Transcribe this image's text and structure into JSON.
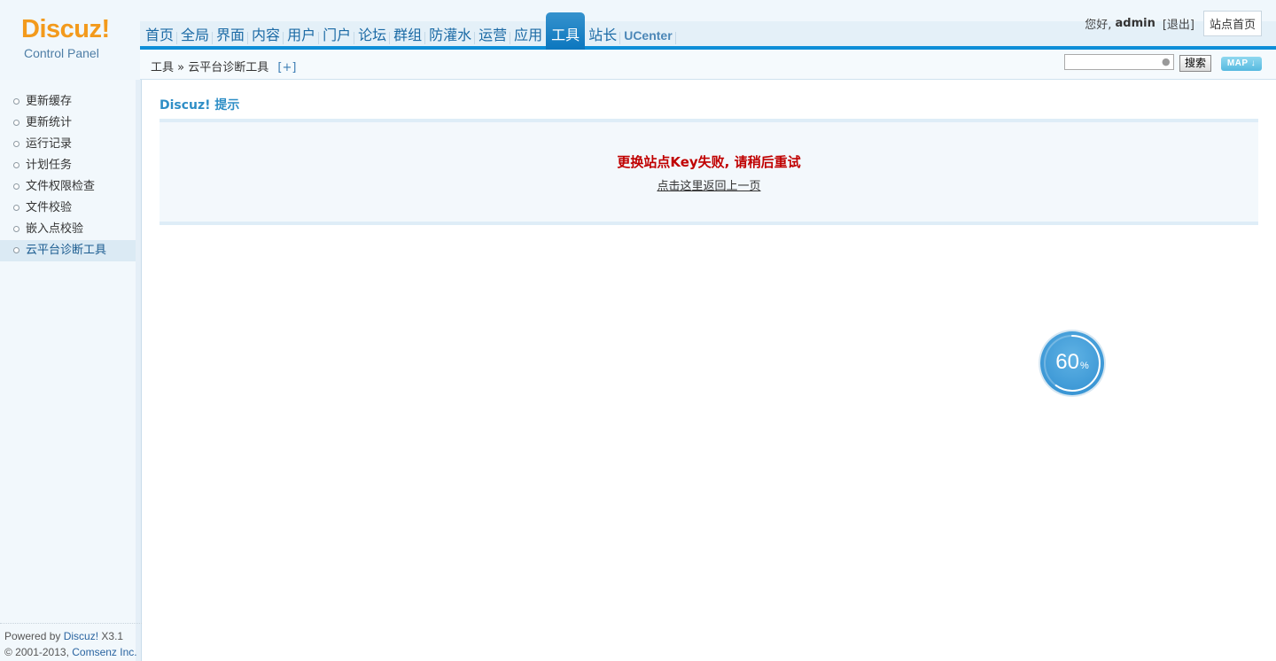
{
  "logo": {
    "brand": "Discuz!",
    "subtitle": "Control Panel"
  },
  "nav": {
    "items": [
      {
        "label": "首页"
      },
      {
        "label": "全局"
      },
      {
        "label": "界面"
      },
      {
        "label": "内容"
      },
      {
        "label": "用户"
      },
      {
        "label": "门户"
      },
      {
        "label": "论坛"
      },
      {
        "label": "群组"
      },
      {
        "label": "防灌水"
      },
      {
        "label": "运营"
      },
      {
        "label": "应用"
      },
      {
        "label": "工具"
      },
      {
        "label": "站长"
      },
      {
        "label": "UCenter"
      }
    ],
    "active": "工具"
  },
  "user": {
    "greeting": "您好,",
    "name": "admin",
    "logout": "[退出]",
    "site_home": "站点首页"
  },
  "breadcrumb": {
    "section": "工具",
    "separator": "»",
    "current": "云平台诊断工具",
    "add": "[+]"
  },
  "search": {
    "value": "",
    "button": "搜索"
  },
  "map_button": "MAP ↓",
  "sidebar": {
    "items": [
      {
        "label": "更新缓存"
      },
      {
        "label": "更新统计"
      },
      {
        "label": "运行记录"
      },
      {
        "label": "计划任务"
      },
      {
        "label": "文件权限检查"
      },
      {
        "label": "文件校验"
      },
      {
        "label": "嵌入点校验"
      },
      {
        "label": "云平台诊断工具"
      }
    ],
    "active_index": 7
  },
  "footer": {
    "powered": "Powered by",
    "product": "Discuz!",
    "version": "X3.1",
    "copyright": "© 2001-2013,",
    "company": "Comsenz Inc."
  },
  "content": {
    "title": "Discuz! 提示",
    "message": "更换站点Key失败, 请稍后重试",
    "back_link": "点击这里返回上一页"
  },
  "progress": {
    "value": 60,
    "unit": "%"
  },
  "colors": {
    "accent": "#0d8ed8",
    "error": "#c00000",
    "logo": "#f39a1c"
  }
}
